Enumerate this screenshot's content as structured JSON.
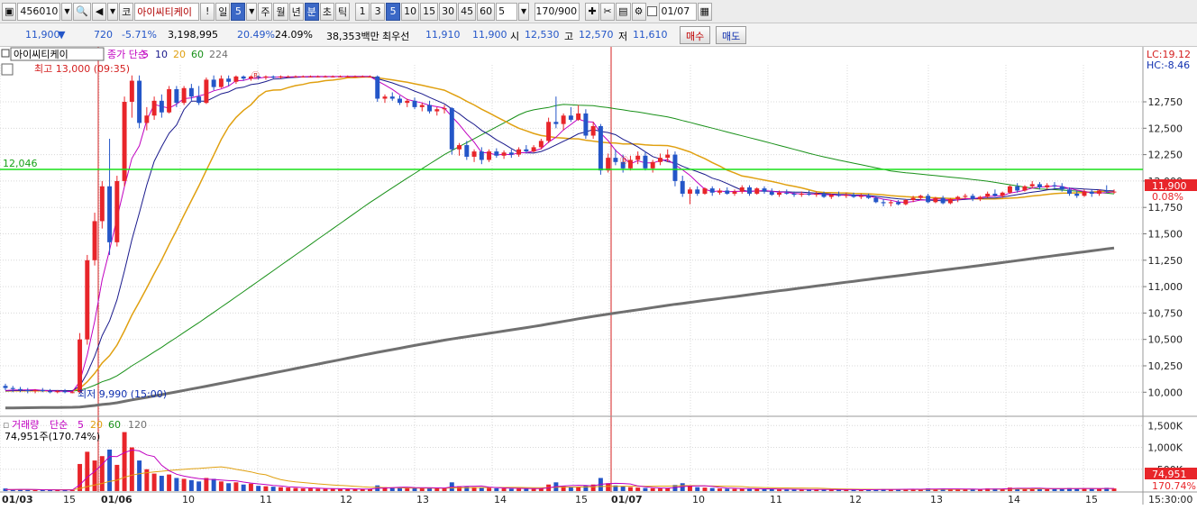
{
  "toolbar": {
    "code": "456010",
    "market": "코",
    "stock_name": "아이씨티케이",
    "period_day": "일",
    "period_value": "5",
    "periods": [
      "주",
      "월",
      "년",
      "분",
      "초",
      "틱"
    ],
    "minute_options": [
      "1",
      "3",
      "5",
      "10",
      "15",
      "30",
      "45",
      "60"
    ],
    "minute_selected": "5",
    "interval_value": "5",
    "count": "170",
    "count_max": "/900",
    "date": "01/07"
  },
  "quote": {
    "price": "11,900",
    "arrow": "▼",
    "change": "720",
    "change_pct": "-5.71%",
    "volume": "3,198,995",
    "vol_ratio": "20.49%",
    "turnover": "24.09%",
    "amount": "38,353백만",
    "best_ask_label": "최우선",
    "best_ask": "11,910",
    "best_bid": "11,900",
    "open_label": "시",
    "open": "12,530",
    "high_label": "고",
    "high": "12,570",
    "low_label": "저",
    "low": "11,610",
    "buy_label": "매수",
    "sell_label": "매도"
  },
  "price_legend": {
    "name": "아이씨티케이",
    "ma_label": "종가 단순",
    "ma_periods": [
      "5",
      "10",
      "20",
      "60",
      "224"
    ],
    "ma_colors": [
      "#c000c0",
      "#1a1a8c",
      "#e0a010",
      "#189018",
      "#707070"
    ],
    "high_note": "최고 13,000 (09:35)",
    "low_note": "최저 9,990 (15:00)",
    "lc": "LC:19.12",
    "hc": "HC:-8.46",
    "hline_value": "12,046",
    "current_price_tag": "11,900",
    "current_pct_tag": "0.08%"
  },
  "volume_legend": {
    "label": "거래량",
    "ma_label": "단순",
    "ma_periods": [
      "5",
      "20",
      "60",
      "120"
    ],
    "ma_colors": [
      "#c000c0",
      "#e0a010",
      "#189018",
      "#707070"
    ],
    "value_text": "74,951주(170.74%)",
    "current_tag": "74,951",
    "pct_tag": "170.74%"
  },
  "colors": {
    "up": "#e8252a",
    "down": "#2456c8",
    "hline": "#18e018",
    "day_line": "#d42020",
    "grid": "#d8d8d8"
  },
  "chart_data": {
    "type": "candlestick",
    "price_axis": {
      "min": 9900,
      "max": 13100,
      "ticks": [
        10000,
        10250,
        10500,
        10750,
        11000,
        11250,
        11500,
        11750,
        12000,
        12250,
        12500,
        12750
      ]
    },
    "volume_axis": {
      "min": 0,
      "max": 1650,
      "unit": "K",
      "ticks": [
        500,
        1000,
        1500
      ],
      "tick_labels": [
        "500K",
        "1,000K",
        "1,500K"
      ]
    },
    "x_labels": [
      "01/03",
      "15",
      "01/06",
      "10",
      "11",
      "12",
      "13",
      "14",
      "15",
      "01/07",
      "10",
      "11",
      "12",
      "13",
      "14",
      "15",
      "15:30:00"
    ],
    "day_boundaries": [
      "01/06",
      "01/07"
    ],
    "candles": [
      [
        10060,
        10080,
        10020,
        10040,
        60
      ],
      [
        10040,
        10060,
        10000,
        10030,
        40
      ],
      [
        10030,
        10050,
        10000,
        10020,
        35
      ],
      [
        10020,
        10040,
        9990,
        10010,
        30
      ],
      [
        10010,
        10030,
        9990,
        10020,
        25
      ],
      [
        10020,
        10040,
        10000,
        10010,
        28
      ],
      [
        10010,
        10030,
        9990,
        10000,
        30
      ],
      [
        10000,
        10020,
        9990,
        10010,
        25
      ],
      [
        10010,
        10030,
        9990,
        10000,
        20
      ],
      [
        10000,
        10010,
        9990,
        10000,
        22
      ],
      [
        10000,
        10560,
        9990,
        10500,
        620
      ],
      [
        10500,
        11300,
        10450,
        11250,
        900
      ],
      [
        11250,
        11700,
        11200,
        11620,
        700
      ],
      [
        11620,
        12000,
        11550,
        11950,
        800
      ],
      [
        11950,
        12400,
        11300,
        11420,
        950
      ],
      [
        11420,
        12050,
        11380,
        12000,
        600
      ],
      [
        12000,
        12800,
        11950,
        12750,
        1350
      ],
      [
        12750,
        13000,
        12600,
        12950,
        1000
      ],
      [
        12950,
        13000,
        12500,
        12550,
        700
      ],
      [
        12550,
        12700,
        12480,
        12620,
        500
      ],
      [
        12620,
        12800,
        12580,
        12760,
        400
      ],
      [
        12760,
        12820,
        12600,
        12650,
        350
      ],
      [
        12650,
        12900,
        12640,
        12870,
        380
      ],
      [
        12870,
        12900,
        12700,
        12740,
        300
      ],
      [
        12740,
        12900,
        12720,
        12880,
        280
      ],
      [
        12880,
        12920,
        12760,
        12800,
        250
      ],
      [
        12800,
        12900,
        12720,
        12740,
        220
      ],
      [
        12740,
        12980,
        12730,
        12960,
        300
      ],
      [
        12960,
        13000,
        12860,
        12890,
        280
      ],
      [
        12890,
        13000,
        12880,
        12970,
        220
      ],
      [
        12970,
        13000,
        12900,
        12940,
        180
      ],
      [
        12940,
        13000,
        12920,
        12990,
        200
      ],
      [
        12990,
        13000,
        12950,
        12970,
        150
      ],
      [
        12970,
        13000,
        12950,
        12990,
        170
      ],
      [
        12990,
        13000,
        12960,
        12980,
        120
      ],
      [
        12980,
        13000,
        12960,
        12990,
        110
      ],
      [
        12990,
        13000,
        12970,
        12980,
        100
      ],
      [
        12980,
        13000,
        12970,
        12990,
        90
      ],
      [
        12990,
        13000,
        12980,
        12990,
        80
      ],
      [
        12990,
        13000,
        12980,
        12990,
        70
      ],
      [
        12990,
        13000,
        12980,
        12990,
        60
      ],
      [
        12990,
        13000,
        12980,
        12990,
        60
      ],
      [
        12990,
        13000,
        12980,
        12990,
        55
      ],
      [
        12990,
        13000,
        12980,
        12990,
        50
      ],
      [
        12990,
        13000,
        12980,
        12990,
        50
      ],
      [
        12990,
        13000,
        12980,
        12990,
        50
      ],
      [
        12990,
        13000,
        12980,
        12990,
        50
      ],
      [
        12990,
        13000,
        12980,
        12990,
        45
      ],
      [
        12990,
        13000,
        12980,
        12990,
        45
      ],
      [
        12990,
        13000,
        12980,
        12990,
        45
      ],
      [
        12990,
        13000,
        12750,
        12780,
        130
      ],
      [
        12780,
        12820,
        12740,
        12800,
        90
      ],
      [
        12800,
        12840,
        12760,
        12780,
        80
      ],
      [
        12780,
        12810,
        12720,
        12740,
        85
      ],
      [
        12740,
        12780,
        12700,
        12760,
        70
      ],
      [
        12760,
        12790,
        12680,
        12700,
        80
      ],
      [
        12700,
        12740,
        12660,
        12720,
        70
      ],
      [
        12720,
        12760,
        12640,
        12660,
        75
      ],
      [
        12660,
        12700,
        12620,
        12680,
        65
      ],
      [
        12680,
        12720,
        12640,
        12690,
        60
      ],
      [
        12690,
        12700,
        12250,
        12300,
        200
      ],
      [
        12300,
        12360,
        12240,
        12340,
        110
      ],
      [
        12340,
        12380,
        12200,
        12230,
        100
      ],
      [
        12230,
        12300,
        12180,
        12280,
        90
      ],
      [
        12280,
        12320,
        12160,
        12200,
        80
      ],
      [
        12200,
        12300,
        12180,
        12280,
        70
      ],
      [
        12280,
        12310,
        12220,
        12240,
        65
      ],
      [
        12240,
        12290,
        12210,
        12270,
        60
      ],
      [
        12270,
        12300,
        12220,
        12250,
        55
      ],
      [
        12250,
        12320,
        12230,
        12300,
        60
      ],
      [
        12300,
        12340,
        12260,
        12280,
        55
      ],
      [
        12280,
        12340,
        12270,
        12320,
        50
      ],
      [
        12320,
        12400,
        12300,
        12380,
        60
      ],
      [
        12380,
        12600,
        12360,
        12560,
        150
      ],
      [
        12560,
        12800,
        12500,
        12540,
        200
      ],
      [
        12540,
        12640,
        12480,
        12620,
        120
      ],
      [
        12620,
        12700,
        12560,
        12580,
        100
      ],
      [
        12580,
        12720,
        12570,
        12640,
        90
      ],
      [
        12640,
        12680,
        12400,
        12430,
        130
      ],
      [
        12430,
        12560,
        12400,
        12520,
        150
      ],
      [
        12520,
        12540,
        12060,
        12100,
        300
      ],
      [
        12100,
        12260,
        12080,
        12220,
        180
      ],
      [
        12220,
        12300,
        12150,
        12180,
        130
      ],
      [
        12180,
        12250,
        12080,
        12120,
        110
      ],
      [
        12120,
        12240,
        12100,
        12200,
        90
      ],
      [
        12200,
        12280,
        12160,
        12240,
        80
      ],
      [
        12240,
        12280,
        12100,
        12120,
        70
      ],
      [
        12120,
        12200,
        12080,
        12180,
        65
      ],
      [
        12180,
        12260,
        12150,
        12220,
        60
      ],
      [
        12220,
        12300,
        12180,
        12250,
        70
      ],
      [
        12250,
        12280,
        11950,
        12000,
        140
      ],
      [
        12000,
        12050,
        11850,
        11880,
        180
      ],
      [
        11880,
        11940,
        11780,
        11920,
        120
      ],
      [
        11920,
        11950,
        11860,
        11880,
        90
      ],
      [
        11880,
        11940,
        11870,
        11930,
        80
      ],
      [
        11930,
        11950,
        11860,
        11890,
        70
      ],
      [
        11890,
        11930,
        11870,
        11910,
        60
      ],
      [
        11910,
        11940,
        11870,
        11880,
        55
      ],
      [
        11880,
        11920,
        11860,
        11900,
        50
      ],
      [
        11900,
        11960,
        11880,
        11940,
        55
      ],
      [
        11940,
        11960,
        11860,
        11880,
        60
      ],
      [
        11880,
        11940,
        11870,
        11930,
        50
      ],
      [
        11930,
        11950,
        11880,
        11900,
        45
      ],
      [
        11900,
        11930,
        11860,
        11870,
        45
      ],
      [
        11870,
        11910,
        11850,
        11890,
        40
      ],
      [
        11890,
        11920,
        11870,
        11880,
        40
      ],
      [
        11880,
        11900,
        11850,
        11870,
        38
      ],
      [
        11870,
        11900,
        11850,
        11880,
        35
      ],
      [
        11880,
        11910,
        11860,
        11870,
        35
      ],
      [
        11870,
        11900,
        11850,
        11880,
        34
      ],
      [
        11880,
        11900,
        11840,
        11850,
        36
      ],
      [
        11850,
        11880,
        11830,
        11870,
        33
      ],
      [
        11870,
        11900,
        11850,
        11860,
        32
      ],
      [
        11860,
        11890,
        11840,
        11870,
        30
      ],
      [
        11870,
        11890,
        11840,
        11850,
        30
      ],
      [
        11850,
        11880,
        11830,
        11860,
        30
      ],
      [
        11860,
        11880,
        11830,
        11840,
        32
      ],
      [
        11840,
        11860,
        11790,
        11800,
        40
      ],
      [
        11800,
        11830,
        11760,
        11790,
        45
      ],
      [
        11790,
        11820,
        11760,
        11800,
        40
      ],
      [
        11800,
        11820,
        11770,
        11780,
        40
      ],
      [
        11780,
        11830,
        11770,
        11820,
        42
      ],
      [
        11820,
        11860,
        11800,
        11840,
        45
      ],
      [
        11840,
        11870,
        11820,
        11860,
        40
      ],
      [
        11860,
        11880,
        11790,
        11800,
        60
      ],
      [
        11800,
        11850,
        11790,
        11840,
        50
      ],
      [
        11840,
        11860,
        11780,
        11790,
        55
      ],
      [
        11790,
        11840,
        11780,
        11830,
        45
      ],
      [
        11830,
        11860,
        11800,
        11850,
        40
      ],
      [
        11850,
        11880,
        11830,
        11860,
        40
      ],
      [
        11860,
        11880,
        11810,
        11830,
        45
      ],
      [
        11830,
        11860,
        11810,
        11850,
        40
      ],
      [
        11850,
        11900,
        11840,
        11880,
        60
      ],
      [
        11880,
        11920,
        11850,
        11860,
        55
      ],
      [
        11860,
        11900,
        11840,
        11890,
        50
      ],
      [
        11890,
        11960,
        11880,
        11950,
        80
      ],
      [
        11950,
        11980,
        11890,
        11910,
        70
      ],
      [
        11910,
        11960,
        11900,
        11950,
        60
      ],
      [
        11950,
        12000,
        11930,
        11970,
        65
      ],
      [
        11970,
        11990,
        11920,
        11940,
        55
      ],
      [
        11940,
        11980,
        11920,
        11960,
        50
      ],
      [
        11960,
        11990,
        11930,
        11950,
        50
      ],
      [
        11950,
        11980,
        11900,
        11920,
        60
      ],
      [
        11920,
        11940,
        11860,
        11880,
        70
      ],
      [
        11880,
        11910,
        11840,
        11860,
        60
      ],
      [
        11860,
        11920,
        11850,
        11900,
        55
      ],
      [
        11900,
        11920,
        11850,
        11880,
        50
      ],
      [
        11880,
        11920,
        11860,
        11910,
        55
      ],
      [
        11910,
        11960,
        11890,
        11900,
        75
      ],
      [
        11900,
        11920,
        11880,
        11900,
        60
      ]
    ]
  }
}
